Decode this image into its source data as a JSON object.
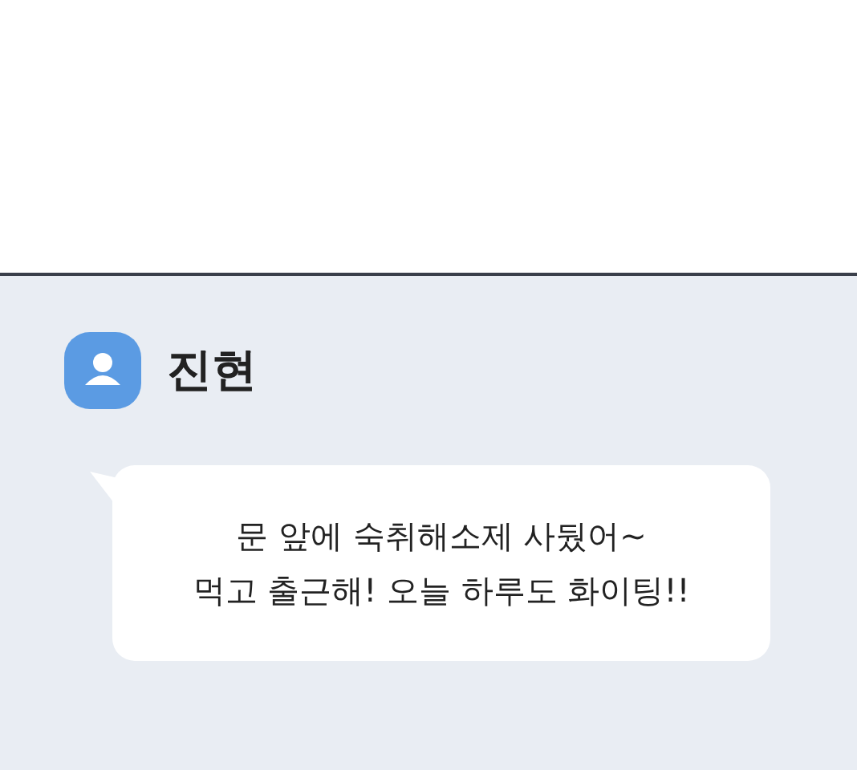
{
  "chat": {
    "sender": "진현",
    "message_lines": [
      "문 앞에 숙취해소제 사뒀어~",
      "먹고 출근해! 오늘 하루도 화이팅!!"
    ]
  }
}
